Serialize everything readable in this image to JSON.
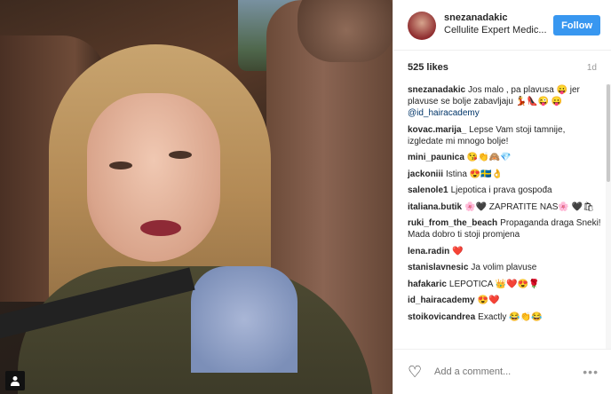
{
  "post": {
    "username": "snezanadakic",
    "location": "Cellulite Expert Medic...",
    "follow_label": "Follow",
    "likes": "525 likes",
    "age": "1d",
    "add_comment_placeholder": "Add a comment...",
    "more_icon": "•••",
    "photo_badge_icon": "person-icon"
  },
  "comments": [
    {
      "user": "snezanadakic",
      "text": "Jos malo , pa plavusa 😛 jer plavuse se bolje zabavljaju 💃👠😜 😛",
      "mention": "@id_hairacademy"
    },
    {
      "user": "kovac.marija_",
      "text": "Lepse Vam stoji tamnije, izgledate mi mnogo bolje!",
      "mention": ""
    },
    {
      "user": "mini_paunica",
      "text": "😘👏🙈💎",
      "mention": ""
    },
    {
      "user": "jackoniii",
      "text": "Istina 😍🇸🇪👌",
      "mention": ""
    },
    {
      "user": "salenole1",
      "text": "Ljepotica i prava gospođa",
      "mention": ""
    },
    {
      "user": "italiana.butik",
      "text": "🌸🖤 ZAPRATITE NAS🌸 🖤🛍",
      "mention": ""
    },
    {
      "user": "ruki_from_the_beach",
      "text": "Propaganda draga Sneki! Mada dobro ti stoji promjena",
      "mention": ""
    },
    {
      "user": "lena.radin",
      "text": "❤️",
      "mention": ""
    },
    {
      "user": "stanislavnesic",
      "text": "Ja volim plavuse",
      "mention": ""
    },
    {
      "user": "hafakaric",
      "text": "LEPOTICA 👑❤️😍🌹",
      "mention": ""
    },
    {
      "user": "id_hairacademy",
      "text": "😍❤️",
      "mention": ""
    },
    {
      "user": "stoikovicandrea",
      "text": "Exactly 😂👏😂",
      "mention": ""
    }
  ],
  "colors": {
    "follow_button": "#3897f0",
    "username": "#262626",
    "muted": "#999999",
    "mention": "#003569"
  }
}
